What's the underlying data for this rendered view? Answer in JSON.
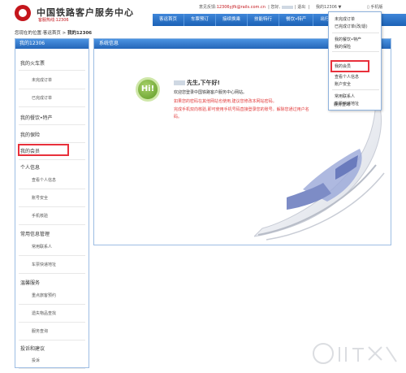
{
  "header": {
    "site_title": "中国铁路客户服务中心",
    "hotline": "客服热线:12306",
    "feedback_label": "意见反馈:",
    "feedback_email": "12306yjfk@rails.com.cn",
    "greeting_prefix": "您好,",
    "logout": "退出",
    "my12306": "我的12306",
    "phone_version": "手机版"
  },
  "nav": [
    "客运首页",
    "车票预订",
    "接续换乘",
    "技能特行",
    "餐饮•特产",
    "出行向导"
  ],
  "dropdown": {
    "items": [
      "未完成订单",
      "已完成订单(改/退)",
      "我的餐饮•特产",
      "我的保险",
      "我的会员",
      "查看个人信息",
      "账户安全",
      "常用联系人",
      "车票快递地址",
      "服务查询"
    ]
  },
  "breadcrumb": {
    "prefix": "您现在的位置:",
    "home": "客运首页",
    "sep": " > ",
    "current": "我的12306"
  },
  "sidebar": {
    "title": "我的12306",
    "items": [
      {
        "label": "我的火车票",
        "level": "top"
      },
      {
        "label": "未完成订单",
        "level": "sub"
      },
      {
        "label": "已完成订单",
        "level": "sub"
      },
      {
        "label": "我的餐饮•特产",
        "level": "top"
      },
      {
        "label": "我的保险",
        "level": "top"
      },
      {
        "label": "我的会员",
        "level": "top"
      },
      {
        "label": "个人信息",
        "level": "top"
      },
      {
        "label": "查看个人信息",
        "level": "sub"
      },
      {
        "label": "账号安全",
        "level": "sub"
      },
      {
        "label": "手机核验",
        "level": "sub"
      },
      {
        "label": "常用信息管理",
        "level": "top"
      },
      {
        "label": "常用联系人",
        "level": "sub"
      },
      {
        "label": "车票快递地址",
        "level": "sub"
      },
      {
        "label": "温馨服务",
        "level": "top"
      },
      {
        "label": "重点旅客预约",
        "level": "sub"
      },
      {
        "label": "遗失物品查找",
        "level": "sub"
      },
      {
        "label": "服务查询",
        "level": "sub"
      },
      {
        "label": "投诉和建议",
        "level": "top"
      },
      {
        "label": "投诉",
        "level": "sub"
      },
      {
        "label": "建议",
        "level": "sub"
      }
    ]
  },
  "main": {
    "title": "系统信息",
    "badge": "Hi!",
    "greeting": "先生,下午好!",
    "lines": [
      {
        "text": "欢迎您登录中国铁路客户服务中心网站。",
        "color": "dark"
      },
      {
        "text": "如果您的密码在其他网站也使用,建议您修改本网站密码。",
        "color": "red"
      },
      {
        "text": "完成手机双向核验,即可使用手机号码直接登录您的账号。解除您通过用户名",
        "color": "red"
      },
      {
        "text": "码。",
        "color": "red"
      }
    ]
  },
  "colors": {
    "brand_blue": "#2466b8",
    "accent_red": "#c4161c",
    "highlight_red": "#e8303b",
    "badge_green": "#5e9a25"
  }
}
